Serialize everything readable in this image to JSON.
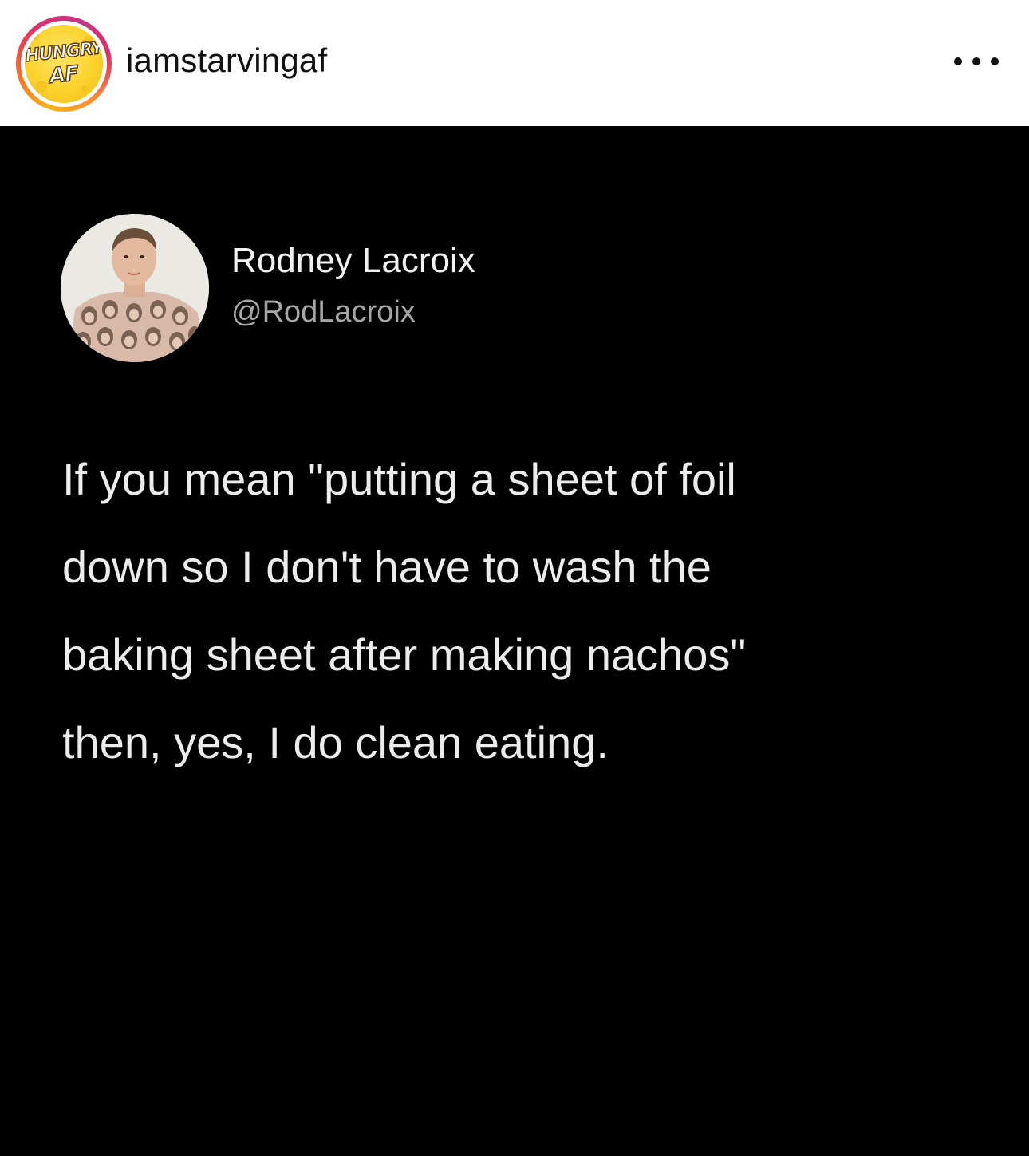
{
  "header": {
    "username": "iamstarvingaf",
    "profile_logo": {
      "line1": "HUNGRY",
      "line2": "AF",
      "accent_color": "#fcd22b"
    },
    "story_ring_colors": [
      "#f9b21a",
      "#f56a2a",
      "#e1306c",
      "#c13584"
    ],
    "more_icon": "more-horizontal-icon"
  },
  "post": {
    "background_color": "#000000",
    "tweet": {
      "display_name": "Rodney Lacroix",
      "handle": "@RodLacroix",
      "text": "If you mean \"putting a sheet of foil\ndown so I don't have to wash the\nbaking sheet after making nachos\"\nthen, yes, I do clean eating."
    }
  }
}
